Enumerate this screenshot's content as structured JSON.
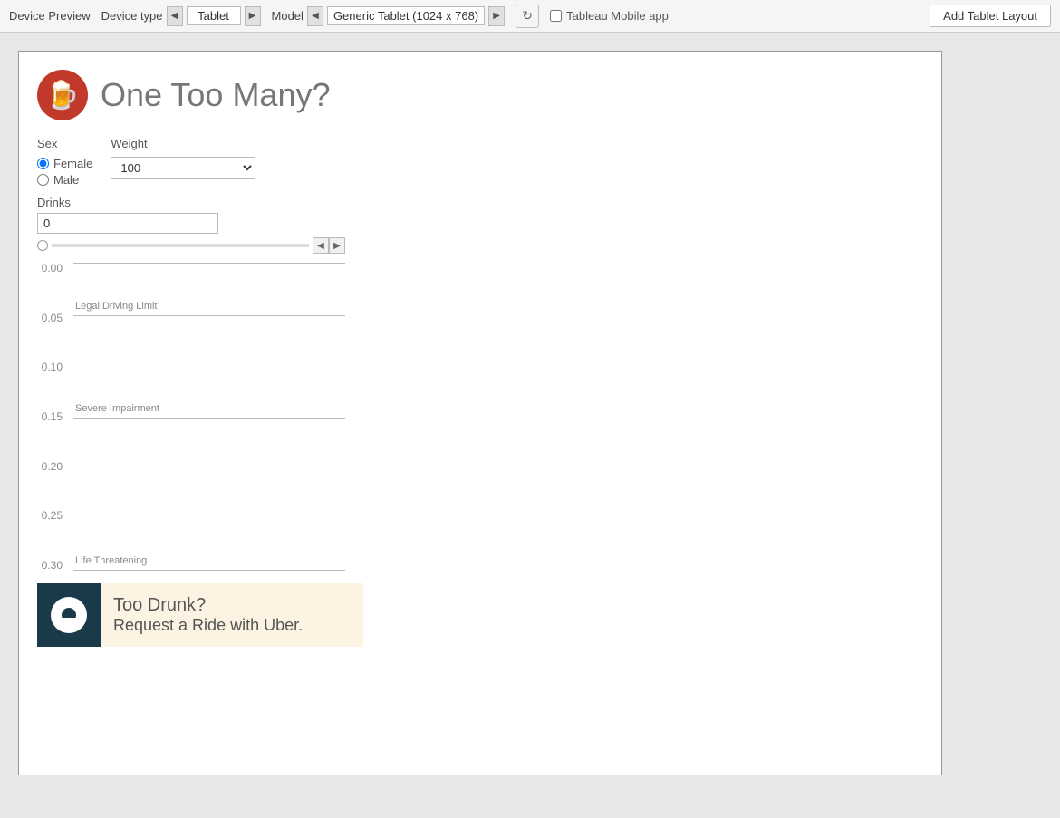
{
  "toolbar": {
    "device_preview_label": "Device Preview",
    "device_type_label": "Device type",
    "device_type_value": "Tablet",
    "model_label": "Model",
    "model_value": "Generic Tablet (1024 x 768)",
    "tableau_mobile_label": "Tableau Mobile app",
    "add_tablet_btn": "Add Tablet Layout"
  },
  "app": {
    "title": "One Too Many?",
    "icon": "🍺"
  },
  "controls": {
    "sex_label": "Sex",
    "female_label": "Female",
    "male_label": "Male",
    "weight_label": "Weight",
    "weight_value": "100",
    "drinks_label": "Drinks",
    "drinks_value": "0"
  },
  "chart": {
    "y_labels": [
      "0.00",
      "0.05",
      "0.10",
      "0.15",
      "0.20",
      "0.25",
      "0.30"
    ],
    "legal_limit_label": "Legal Driving Limit",
    "severe_impairment_label": "Severe Impairment",
    "life_threatening_label": "Life Threatening"
  },
  "uber": {
    "line1": "Too Drunk?",
    "line2": "Request a Ride with Uber."
  }
}
